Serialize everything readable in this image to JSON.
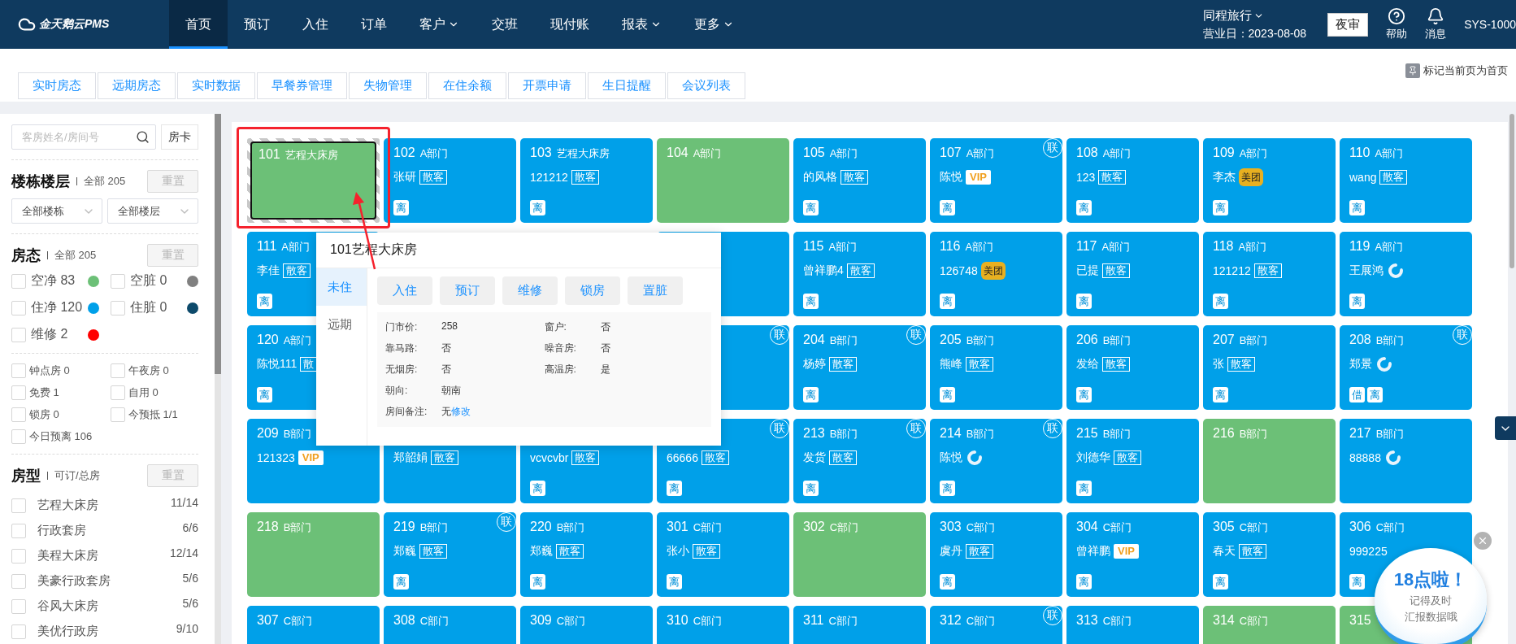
{
  "brand": {
    "name": "金天鹅云PMS"
  },
  "nav": [
    {
      "label": "首页",
      "selected": true,
      "dropdown": false
    },
    {
      "label": "预订",
      "selected": false,
      "dropdown": false
    },
    {
      "label": "入住",
      "selected": false,
      "dropdown": false
    },
    {
      "label": "订单",
      "selected": false,
      "dropdown": false
    },
    {
      "label": "客户",
      "selected": false,
      "dropdown": true
    },
    {
      "label": "交班",
      "selected": false,
      "dropdown": false
    },
    {
      "label": "现付账",
      "selected": false,
      "dropdown": false
    },
    {
      "label": "报表",
      "selected": false,
      "dropdown": true
    },
    {
      "label": "更多",
      "selected": false,
      "dropdown": true
    }
  ],
  "account": {
    "org": "同程旅行",
    "business_day": "营业日：2023-08-08",
    "audit_button": "夜审",
    "help": "帮助",
    "messages": "消息",
    "user": "SYS-1000"
  },
  "tabs": [
    "实时房态",
    "远期房态",
    "实时数据",
    "早餐券管理",
    "失物管理",
    "在住余额",
    "开票申请",
    "生日提醒",
    "会议列表"
  ],
  "pin_home": "标记当前页为首页",
  "sidebar": {
    "search": {
      "placeholder": "客房姓名/房间号"
    },
    "card_button": "房卡",
    "floors": {
      "title": "楼栋楼层",
      "summary": "全部 205",
      "reset": {
        "label": "重置",
        "disabled": true
      },
      "selects": [
        "全部楼栋",
        "全部楼层"
      ]
    },
    "status": {
      "title": "房态",
      "summary": "全部 205",
      "reset": {
        "label": "重置",
        "disabled": true
      },
      "items": [
        {
          "label": "空净 83",
          "checked": false,
          "color": "#6cc077"
        },
        {
          "label": "空脏 0",
          "checked": false,
          "color": "#808080"
        },
        {
          "label": "住净 120",
          "checked": false,
          "color": "#00a0e9"
        },
        {
          "label": "住脏 0",
          "checked": false,
          "color": "#0d4a6b"
        },
        {
          "label": "维修 2",
          "checked": false,
          "color": "#ff0000"
        }
      ],
      "flags": [
        {
          "label": "钟点房 0",
          "checked": false
        },
        {
          "label": "午夜房 0",
          "checked": false
        },
        {
          "label": "免费 1",
          "checked": false
        },
        {
          "label": "自用 0",
          "checked": false
        },
        {
          "label": "锁房 0",
          "checked": false
        },
        {
          "label": "今预抵 1/1",
          "checked": false
        },
        {
          "label": "今日预离 106",
          "checked": false
        }
      ]
    },
    "room_types": {
      "title": "房型",
      "summary": "可订/总房",
      "reset": {
        "label": "重置",
        "disabled": true
      },
      "items": [
        {
          "name": "艺程大床房",
          "count": "11/14",
          "checked": false
        },
        {
          "name": "行政套房",
          "count": "6/6",
          "checked": false
        },
        {
          "name": "美程大床房",
          "count": "12/14",
          "checked": false
        },
        {
          "name": "美豪行政套房",
          "count": "5/6",
          "checked": false
        },
        {
          "name": "谷风大床房",
          "count": "5/6",
          "checked": false
        },
        {
          "name": "美优行政房",
          "count": "9/10",
          "checked": false
        }
      ]
    }
  },
  "rooms": [
    {
      "kind": "vacant",
      "selected": true,
      "number": "101",
      "label": "艺程大床房"
    },
    {
      "kind": "occupied",
      "selected": false,
      "number": "102",
      "label": "A部门",
      "guest": "张研",
      "tag": {
        "kind": "walkin",
        "text": "散客"
      },
      "badges": [
        "离"
      ]
    },
    {
      "kind": "occupied",
      "selected": false,
      "number": "103",
      "label": "艺程大床房",
      "guest": "121212",
      "tag": {
        "kind": "walkin",
        "text": "散客"
      },
      "badges": [
        "离"
      ]
    },
    {
      "kind": "vacant",
      "selected": false,
      "number": "104",
      "label": "A部门"
    },
    {
      "kind": "occupied",
      "selected": false,
      "number": "105",
      "label": "A部门",
      "guest": "的风格",
      "tag": {
        "kind": "walkin",
        "text": "散客"
      },
      "badges": [
        "离"
      ]
    },
    {
      "kind": "occupied",
      "selected": false,
      "number": "107",
      "label": "A部门",
      "guest": "陈悦",
      "tag": {
        "kind": "vip",
        "text": "VIP"
      },
      "badges": [
        "离"
      ],
      "link": "联"
    },
    {
      "kind": "occupied",
      "selected": false,
      "number": "108",
      "label": "A部门",
      "guest": "123",
      "tag": {
        "kind": "walkin",
        "text": "散客"
      },
      "badges": [
        "离"
      ]
    },
    {
      "kind": "occupied",
      "selected": false,
      "number": "109",
      "label": "A部门",
      "guest": "李杰",
      "tag": {
        "kind": "meituan",
        "text": "美团"
      },
      "badges": [
        "离"
      ]
    },
    {
      "kind": "occupied",
      "selected": false,
      "number": "110",
      "label": "A部门",
      "guest": "wang",
      "tag": {
        "kind": "walkin",
        "text": "散客"
      },
      "badges": [
        "离"
      ]
    },
    {
      "kind": "occupied",
      "selected": false,
      "number": "111",
      "label": "A部门",
      "guest": "李佳",
      "tag": {
        "kind": "walkin",
        "text": "散客"
      },
      "badges": [
        "离"
      ]
    },
    {
      "kind": "covered"
    },
    {
      "kind": "covered"
    },
    {
      "kind": "occupied",
      "selected": false
    },
    {
      "kind": "occupied",
      "selected": false,
      "number": "115",
      "label": "A部门",
      "guest": "曾祥鹏4",
      "tag": {
        "kind": "walkin",
        "text": "散客"
      },
      "badges": [
        "离"
      ]
    },
    {
      "kind": "occupied",
      "selected": false,
      "number": "116",
      "label": "A部门",
      "guest": "126748",
      "tag": {
        "kind": "meituan",
        "text": "美团"
      },
      "badges": [
        "离"
      ]
    },
    {
      "kind": "occupied",
      "selected": false,
      "number": "117",
      "label": "A部门",
      "guest": "已提",
      "tag": {
        "kind": "walkin",
        "text": "散客"
      },
      "badges": [
        "离"
      ]
    },
    {
      "kind": "occupied",
      "selected": false,
      "number": "118",
      "label": "A部门",
      "guest": "121212",
      "tag": {
        "kind": "walkin",
        "text": "散客"
      },
      "badges": [
        "离"
      ]
    },
    {
      "kind": "occupied",
      "selected": false,
      "number": "119",
      "label": "A部门",
      "guest": "王展鸿",
      "tag": {
        "kind": "ctrip"
      },
      "badges": [
        "离"
      ]
    },
    {
      "kind": "occupied",
      "selected": false,
      "number": "120",
      "label": "A部门",
      "guest": "陈悦111",
      "tag": {
        "kind": "walkin",
        "text": "散"
      },
      "badges": [
        "离"
      ]
    },
    {
      "kind": "covered"
    },
    {
      "kind": "covered"
    },
    {
      "kind": "occupied",
      "selected": false,
      "link": "联"
    },
    {
      "kind": "occupied",
      "selected": false,
      "number": "204",
      "label": "B部门",
      "guest": "杨婷",
      "tag": {
        "kind": "walkin",
        "text": "散客"
      },
      "badges": [
        "离"
      ],
      "link": "联"
    },
    {
      "kind": "occupied",
      "selected": false,
      "number": "205",
      "label": "B部门",
      "guest": "熊峰",
      "tag": {
        "kind": "walkin",
        "text": "散客"
      },
      "badges": [
        "离"
      ]
    },
    {
      "kind": "occupied",
      "selected": false,
      "number": "206",
      "label": "B部门",
      "guest": "发给",
      "tag": {
        "kind": "walkin",
        "text": "散客"
      },
      "badges": [
        "离"
      ]
    },
    {
      "kind": "occupied",
      "selected": false,
      "number": "207",
      "label": "B部门",
      "guest": "张",
      "tag": {
        "kind": "walkin",
        "text": "散客"
      },
      "badges": [
        "离"
      ]
    },
    {
      "kind": "occupied",
      "selected": false,
      "number": "208",
      "label": "B部门",
      "guest": "郑景",
      "tag": {
        "kind": "ctrip"
      },
      "badges": [
        "借",
        "离"
      ],
      "link": "联"
    },
    {
      "kind": "occupied",
      "selected": false,
      "number": "209",
      "label": "B部门",
      "guest": "121323",
      "tag": {
        "kind": "vip",
        "text": "VIP"
      }
    },
    {
      "kind": "occupied",
      "selected": false,
      "guest": "郑韶娟",
      "tag": {
        "kind": "walkin",
        "text": "散客"
      }
    },
    {
      "kind": "occupied",
      "selected": false,
      "guest": "vcvcvbr",
      "tag": {
        "kind": "walkin",
        "text": "散客"
      },
      "badges": [
        "离"
      ]
    },
    {
      "kind": "occupied",
      "selected": false,
      "guest": "66666",
      "tag": {
        "kind": "walkin",
        "text": "散客"
      },
      "badges": [
        "离"
      ],
      "link": "联"
    },
    {
      "kind": "occupied",
      "selected": false,
      "number": "213",
      "label": "B部门",
      "guest": "发货",
      "tag": {
        "kind": "walkin",
        "text": "散客"
      },
      "badges": [
        "离"
      ],
      "link": "联"
    },
    {
      "kind": "occupied",
      "selected": false,
      "number": "214",
      "label": "B部门",
      "guest": "陈悦",
      "tag": {
        "kind": "ctrip"
      },
      "badges": [
        "离"
      ],
      "link": "联"
    },
    {
      "kind": "occupied",
      "selected": false,
      "number": "215",
      "label": "B部门",
      "guest": "刘德华",
      "tag": {
        "kind": "walkin",
        "text": "散客"
      },
      "badges": [
        "离"
      ]
    },
    {
      "kind": "vacant",
      "selected": false,
      "number": "216",
      "label": "B部门"
    },
    {
      "kind": "occupied",
      "selected": false,
      "number": "217",
      "label": "B部门",
      "guest": "88888",
      "tag": {
        "kind": "ctrip"
      }
    },
    {
      "kind": "vacant",
      "selected": false,
      "number": "218",
      "label": "B部门"
    },
    {
      "kind": "occupied",
      "selected": false,
      "number": "219",
      "label": "B部门",
      "guest": "郑巍",
      "tag": {
        "kind": "walkin",
        "text": "散客"
      },
      "badges": [
        "离"
      ],
      "link": "联"
    },
    {
      "kind": "occupied",
      "selected": false,
      "number": "220",
      "label": "B部门",
      "guest": "郑巍",
      "tag": {
        "kind": "walkin",
        "text": "散客"
      },
      "badges": [
        "离"
      ]
    },
    {
      "kind": "occupied",
      "selected": false,
      "number": "301",
      "label": "C部门",
      "guest": "张小",
      "tag": {
        "kind": "walkin",
        "text": "散客"
      },
      "badges": [
        "离"
      ]
    },
    {
      "kind": "vacant",
      "selected": false,
      "number": "302",
      "label": "C部门"
    },
    {
      "kind": "occupied",
      "selected": false,
      "number": "303",
      "label": "C部门",
      "guest": "虞丹",
      "tag": {
        "kind": "walkin",
        "text": "散客"
      },
      "badges": [
        "离"
      ]
    },
    {
      "kind": "occupied",
      "selected": false,
      "number": "304",
      "label": "C部门",
      "guest": "曾祥鹏",
      "tag": {
        "kind": "vip",
        "text": "VIP"
      },
      "badges": [
        "离"
      ]
    },
    {
      "kind": "occupied",
      "selected": false,
      "number": "305",
      "label": "C部门",
      "guest": "春天",
      "tag": {
        "kind": "walkin",
        "text": "散客"
      },
      "badges": [
        "离"
      ]
    },
    {
      "kind": "occupied",
      "selected": false,
      "number": "306",
      "label": "C部门",
      "guest": "999225",
      "badges": [
        "离"
      ]
    },
    {
      "kind": "occupied",
      "selected": false,
      "number": "307",
      "label": "C部门"
    },
    {
      "kind": "occupied",
      "selected": false,
      "number": "308",
      "label": "C部门"
    },
    {
      "kind": "occupied",
      "selected": false,
      "number": "309",
      "label": "C部门"
    },
    {
      "kind": "occupied",
      "selected": false,
      "number": "310",
      "label": "C部门"
    },
    {
      "kind": "occupied",
      "selected": false,
      "number": "311",
      "label": "C部门"
    },
    {
      "kind": "occupied",
      "selected": false,
      "number": "312",
      "label": "C部门",
      "link": "联"
    },
    {
      "kind": "occupied",
      "selected": false,
      "number": "313",
      "label": "C部门"
    },
    {
      "kind": "vacant",
      "selected": false,
      "number": "314",
      "label": "C部门"
    },
    {
      "kind": "vacant",
      "selected": false,
      "number": "315"
    }
  ],
  "popup": {
    "title": "101艺程大床房",
    "tabs": [
      {
        "label": "未住",
        "selected": true
      },
      {
        "label": "远期",
        "selected": false
      }
    ],
    "actions": [
      "入住",
      "预订",
      "维修",
      "锁房",
      "置脏"
    ],
    "details": [
      {
        "label": "门市价:",
        "value": "258"
      },
      {
        "label": "窗户:",
        "value": "否"
      },
      {
        "label": "靠马路:",
        "value": "否"
      },
      {
        "label": "噪音房:",
        "value": "否"
      },
      {
        "label": "无烟房:",
        "value": "否"
      },
      {
        "label": "高温房:",
        "value": "是"
      },
      {
        "label": "朝向:",
        "value": "朝南"
      }
    ],
    "note": {
      "label": "房间备注:",
      "value": "无",
      "link": "修改"
    }
  },
  "reminder": {
    "title": "18点啦！",
    "lines": [
      "记得及时",
      "汇报数据哦"
    ]
  }
}
